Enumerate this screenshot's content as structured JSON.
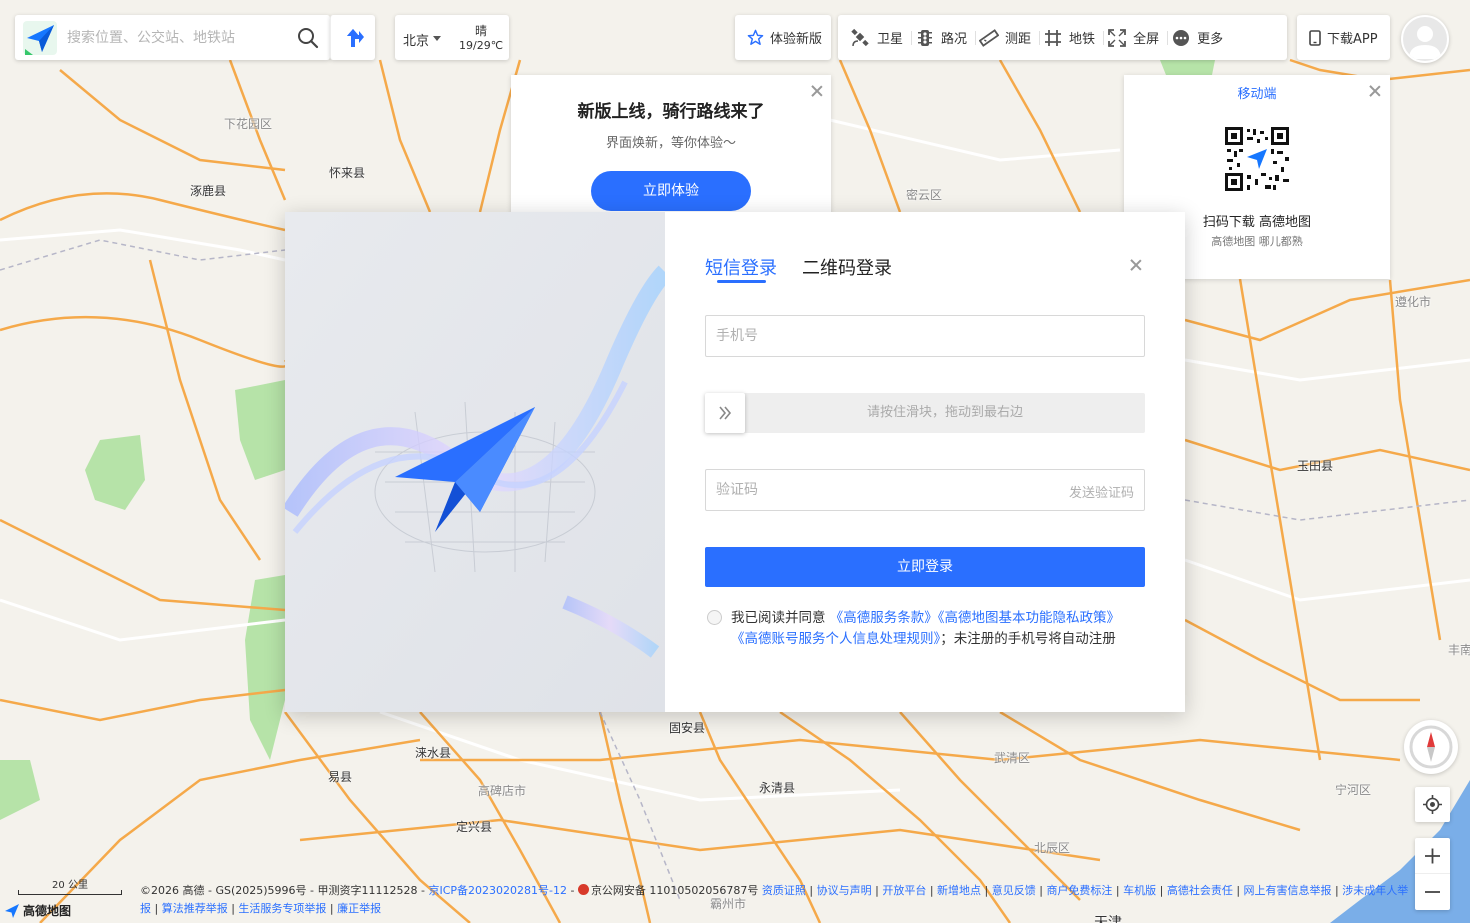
{
  "map": {
    "places": [
      {
        "name": "下花园区",
        "grey": true
      },
      {
        "name": "涿鹿县",
        "grey": false
      },
      {
        "name": "怀来县",
        "grey": false
      },
      {
        "name": "密云区",
        "grey": true
      },
      {
        "name": "遵化市",
        "grey": true
      },
      {
        "name": "玉田县",
        "grey": false
      },
      {
        "name": "固安县",
        "grey": false
      },
      {
        "name": "涞水县",
        "grey": false
      },
      {
        "name": "易县",
        "grey": false
      },
      {
        "name": "高碑店市",
        "grey": true
      },
      {
        "name": "永清县",
        "grey": false
      },
      {
        "name": "武清区",
        "grey": true
      },
      {
        "name": "宁河区",
        "grey": true
      },
      {
        "name": "定兴县",
        "grey": false
      },
      {
        "name": "北辰区",
        "grey": true
      },
      {
        "name": "丰南",
        "grey": true
      },
      {
        "name": "霸州市",
        "grey": true
      },
      {
        "name": "天津",
        "grey": false
      }
    ]
  },
  "search": {
    "placeholder": "搜索位置、公交站、地铁站"
  },
  "city": {
    "name": "北京",
    "weather": "晴",
    "temp": "19/29℃"
  },
  "toolbar": {
    "try_new": "体验新版",
    "tools": [
      {
        "label": "卫星",
        "icon": "satellite-icon"
      },
      {
        "label": "路况",
        "icon": "traffic-light-icon"
      },
      {
        "label": "测距",
        "icon": "ruler-icon"
      },
      {
        "label": "地铁",
        "icon": "subway-icon"
      },
      {
        "label": "全屏",
        "icon": "fullscreen-icon"
      },
      {
        "label": "更多",
        "icon": "more-icon"
      }
    ],
    "download_app": "下载APP"
  },
  "promo": {
    "title": "新版上线，骑行路线来了",
    "subtitle": "界面焕新，等你体验～",
    "button": "立即体验"
  },
  "mobile": {
    "title": "移动端",
    "line1": "扫码下载 高德地图",
    "line2": "高德地图 哪儿都熟"
  },
  "login": {
    "tab_sms": "短信登录",
    "tab_qr": "二维码登录",
    "phone_placeholder": "手机号",
    "slider_hint": "请按住滑块，拖动到最右边",
    "code_placeholder": "验证码",
    "send_code": "发送验证码",
    "submit": "立即登录",
    "agree_prefix": "我已阅读并同意",
    "terms": "《高德服务条款》",
    "privacy": "《高德地图基本功能隐私政策》",
    "personal_info": "《高德账号服务个人信息处理规则》",
    "agree_suffix": "；未注册的手机号将自动注册"
  },
  "scale": {
    "label": "20 公里"
  },
  "brand": {
    "name": "高德地图"
  },
  "footer": {
    "copyright": "©2026 高德 - GS(2025)5996号 - 甲测资字11112528 - ",
    "icp": "京ICP备2023020281号-12",
    "sep": " - ",
    "police": "京公网安备 11010502056787号",
    "links": [
      "资质证照",
      "协议与声明",
      "开放平台",
      "新增地点",
      "意见反馈",
      "商户免费标注",
      "车机版",
      "高德社会责任",
      "网上有害信息举报",
      "涉未成年人举报",
      "算法推荐举报",
      "生活服务专项举报",
      "廉正举报"
    ]
  },
  "colors": {
    "accent": "#2a6fff",
    "road_major": "#f5a94a",
    "road_minor": "#ffffff",
    "green_area": "#b6e3a8",
    "water": "#7aaee8"
  }
}
